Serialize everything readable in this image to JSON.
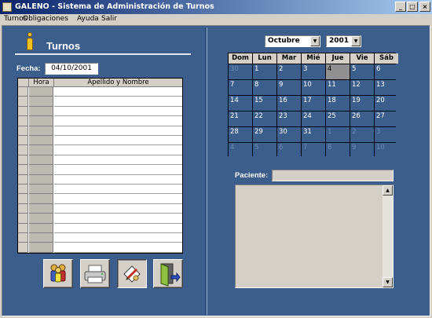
{
  "window": {
    "title": "GALENO - Sistema de Administración de Turnos"
  },
  "title_buttons": {
    "minimize": "_",
    "maximize": "□",
    "close": "×"
  },
  "menu": [
    "Turnos",
    "Obligaciones",
    "Ayuda",
    "Salir"
  ],
  "left": {
    "heading": "Turnos",
    "fecha_label": "Fecha:",
    "fecha_value": "04/10/2001",
    "grid": {
      "columns": [
        "",
        "Hora",
        "Apellido y Nombre"
      ],
      "row_count": 17
    }
  },
  "toolbar": [
    {
      "name": "patients-button",
      "icon": "people-icon"
    },
    {
      "name": "print-button",
      "icon": "printer-icon"
    },
    {
      "name": "edit-button",
      "icon": "pencil-document-icon"
    },
    {
      "name": "exit-button",
      "icon": "exit-door-icon"
    }
  ],
  "calendar": {
    "month": "Octubre",
    "year": "2001",
    "weekdays": [
      "Dom",
      "Lun",
      "Mar",
      "Mié",
      "Jue",
      "Vie",
      "Sáb"
    ],
    "weeks": [
      [
        "30",
        "1",
        "2",
        "3",
        "4",
        "5",
        "6"
      ],
      [
        "7",
        "8",
        "9",
        "10",
        "11",
        "12",
        "13"
      ],
      [
        "14",
        "15",
        "16",
        "17",
        "18",
        "19",
        "20"
      ],
      [
        "21",
        "22",
        "23",
        "24",
        "25",
        "26",
        "27"
      ],
      [
        "28",
        "29",
        "30",
        "31",
        "1",
        "2",
        "3"
      ],
      [
        "4",
        "5",
        "6",
        "7",
        "8",
        "9",
        "10"
      ]
    ],
    "selected": "4"
  },
  "paciente": {
    "label": "Paciente:",
    "value": ""
  },
  "colors": {
    "panel": "#3b5e8c",
    "titlebar_start": "#0a246a",
    "titlebar_end": "#a6caf0"
  }
}
